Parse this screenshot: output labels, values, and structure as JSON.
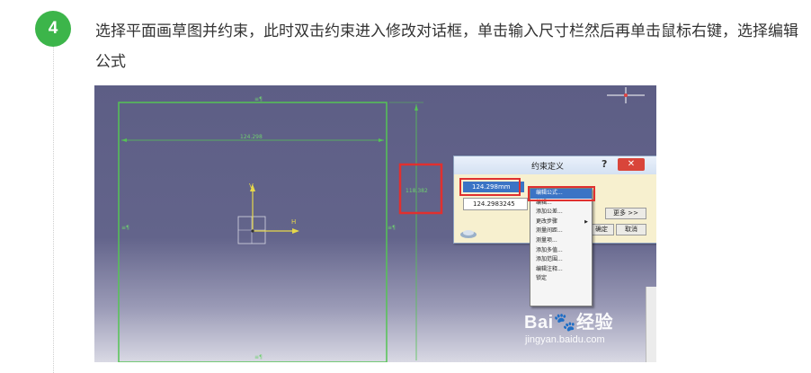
{
  "step": {
    "number": "4",
    "text": "选择平面画草图并约束，此时双击约束进入修改对话框，单击输入尺寸栏然后再单击鼠标右键，选择编辑公式"
  },
  "colors": {
    "badge": "#3cb54a",
    "sketch_line": "#55c455",
    "highlight_red": "#e0302f",
    "selection_blue": "#3b74c5"
  },
  "cad": {
    "width_label": "124.298",
    "height_label": "118.382",
    "axis_v": "V",
    "axis_h": "H"
  },
  "dialog": {
    "title": "约束定义",
    "help": "?",
    "close": "✕",
    "selected_value": "124.298mm",
    "second_value": "124.2983245",
    "more_button": "更多 >>",
    "ok_button": "确定",
    "cancel_button": "取消"
  },
  "context_menu": {
    "items": [
      {
        "label": "编辑公式..."
      },
      {
        "label": "编辑..."
      },
      {
        "label": "添加公差..."
      },
      {
        "label": "更改步骤"
      },
      {
        "label": "测量间距..."
      },
      {
        "label": "测量项..."
      },
      {
        "label": "添加多值..."
      },
      {
        "label": "添加范围..."
      },
      {
        "label": "编辑注释..."
      },
      {
        "label": "锁定"
      }
    ]
  },
  "watermark": {
    "logo": "Bai🐾经验",
    "url": "jingyan.baidu.com"
  }
}
